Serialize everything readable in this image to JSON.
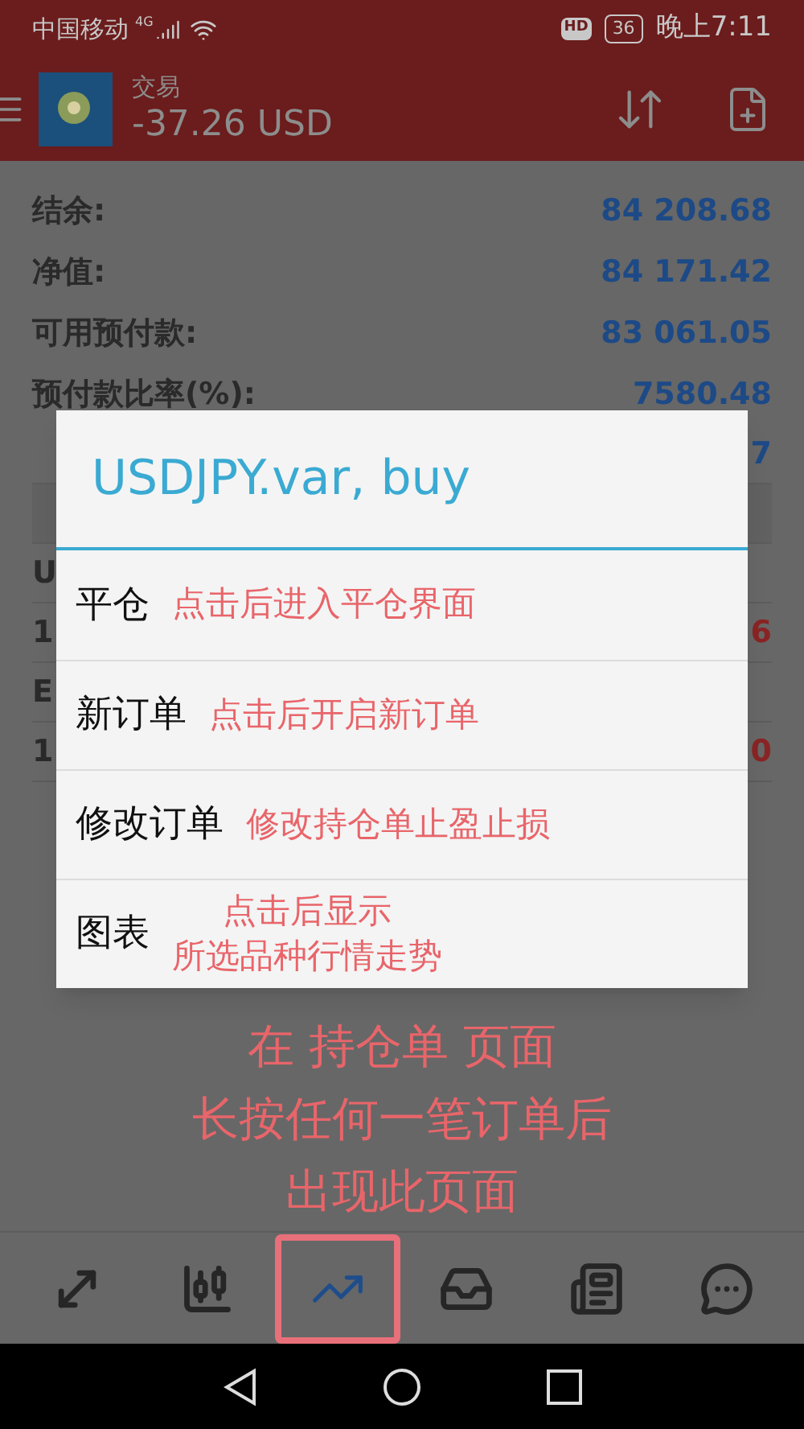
{
  "status_bar": {
    "carrier": "中国移动",
    "network": "4G",
    "hd": "HD",
    "battery": "36",
    "time": "晚上7:11"
  },
  "app_bar": {
    "title": "交易",
    "balance": "-37.26 USD"
  },
  "account": [
    {
      "label": "结余:",
      "value": "84 208.68"
    },
    {
      "label": "净值:",
      "value": "84 171.42"
    },
    {
      "label": "可用预付款:",
      "value": "83 061.05"
    },
    {
      "label": "预付款比率(%):",
      "value": "7580.48"
    }
  ],
  "covered_rows": [
    {
      "kind": "row",
      "value_part": "7"
    },
    {
      "kind": "header"
    },
    {
      "kind": "row",
      "name_part": "U"
    },
    {
      "kind": "row",
      "name_part": "1",
      "value_part": "6"
    },
    {
      "kind": "row",
      "name_part": "E"
    },
    {
      "kind": "row",
      "name_part": "1",
      "value_part": "0"
    }
  ],
  "dialog": {
    "title": "USDJPY.var, buy",
    "items": [
      {
        "label": "平仓",
        "note": "点击后进入平仓界面"
      },
      {
        "label": "新订单",
        "note": "点击后开启新订单"
      },
      {
        "label": "修改订单",
        "note": "修改持仓单止盈止损"
      },
      {
        "label": "图表",
        "note": "点击后显示",
        "note2": "所选品种行情走势"
      }
    ]
  },
  "annotation": [
    "在 持仓单 页面",
    "长按任何一笔订单后",
    "出现此页面"
  ],
  "tabs": [
    {
      "kind": "trade",
      "selected": false,
      "annotated": false
    },
    {
      "kind": "candles",
      "selected": false,
      "annotated": false
    },
    {
      "kind": "trend",
      "selected": true,
      "annotated": true
    },
    {
      "kind": "inbox",
      "selected": false,
      "annotated": false
    },
    {
      "kind": "news",
      "selected": false,
      "annotated": false
    },
    {
      "kind": "chat",
      "selected": false,
      "annotated": false
    }
  ]
}
